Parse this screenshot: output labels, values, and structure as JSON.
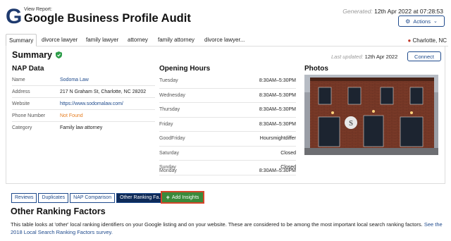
{
  "header": {
    "subtitle": "View Report:",
    "title": "Google Business Profile Audit",
    "generated_label": "Generated:",
    "generated_value": "12th Apr 2022 at 07:28:53",
    "actions_label": "Actions"
  },
  "tabs": [
    {
      "label": "Summary"
    },
    {
      "label": "divorce lawyer"
    },
    {
      "label": "family lawyer"
    },
    {
      "label": "attorney"
    },
    {
      "label": "family attorney"
    },
    {
      "label": "divorce lawyer..."
    }
  ],
  "location": "Charlotte, NC",
  "summary": {
    "title": "Summary",
    "last_updated_label": "Last updated:",
    "last_updated_value": "12th Apr 2022",
    "connect_label": "Connect"
  },
  "nap": {
    "title": "NAP Data",
    "rows": [
      {
        "key": "Name",
        "value": "Sodoma Law"
      },
      {
        "key": "Address",
        "value": "217 N Graham St, Charlotte, NC 28202"
      },
      {
        "key": "Website",
        "value": "https://www.sodomalaw.com/"
      },
      {
        "key": "Phone Number",
        "value": "Not Found"
      },
      {
        "key": "Category",
        "value": "Family law attorney"
      }
    ]
  },
  "hours": {
    "title": "Opening Hours",
    "rows": [
      {
        "day": "Tuesday",
        "time": "8:30AM–5:30PM"
      },
      {
        "day": "Wednesday",
        "time": "8:30AM–5:30PM"
      },
      {
        "day": "Thursday",
        "time": "8:30AM–5:30PM"
      },
      {
        "day": "Friday",
        "time": "8:30AM–5:30PM"
      },
      {
        "day": "GoodFriday",
        "time": "Hoursmightdiffer"
      },
      {
        "day": "Saturday",
        "time": "Closed"
      },
      {
        "day": "Sunday",
        "time": "Closed"
      },
      {
        "day": "Monday",
        "time": "8:30AM–5:30PM"
      }
    ]
  },
  "photos": {
    "title": "Photos"
  },
  "subtabs": [
    {
      "label": "Reviews"
    },
    {
      "label": "Duplicates"
    },
    {
      "label": "NAP Comparison"
    },
    {
      "label": "Other Ranking Fa..."
    }
  ],
  "add_insights_label": "Add Insights",
  "orf": {
    "title": "Other Ranking Factors",
    "text": "This table looks at 'other' local ranking identifiers on your Google listing and on your website. These are considered to be among the most important local search ranking factors.",
    "link_text": "See the 2018 Local Search Ranking Factors survey."
  },
  "colors": {
    "brand": "#1e4a8c",
    "warning": "#e67e22",
    "add_button": "#3a8a3a",
    "add_border": "#d6452a",
    "verified": "#2e9d4a"
  }
}
